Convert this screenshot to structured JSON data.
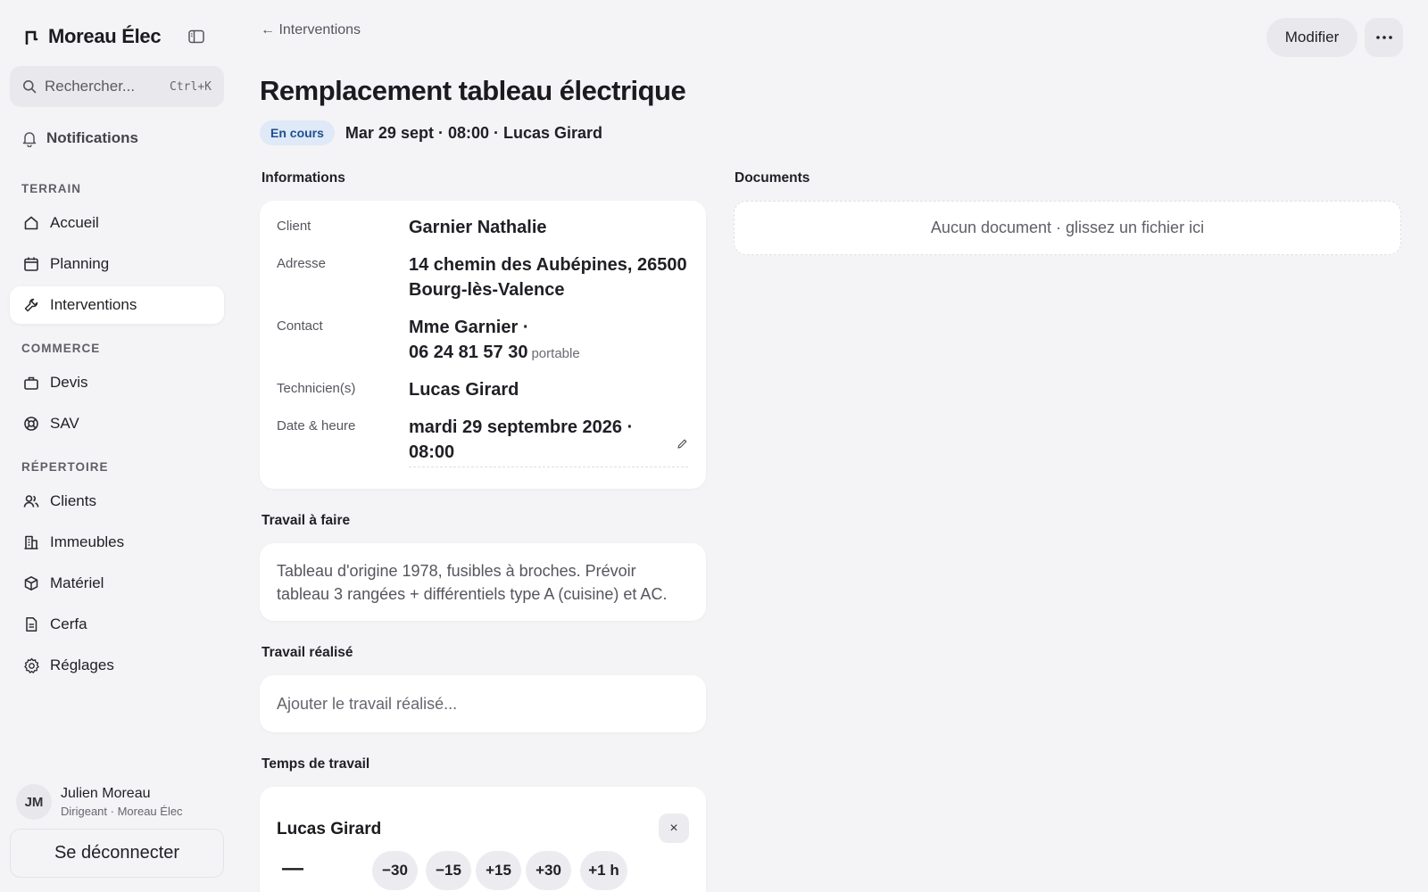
{
  "sidebar": {
    "brand": "Moreau Élec",
    "search_placeholder": "Rechercher...",
    "search_shortcut": "Ctrl+K",
    "notifications": "Notifications",
    "sections": {
      "terrain": "TERRAIN",
      "commerce": "COMMERCE",
      "repertoire": "RÉPERTOIRE"
    },
    "items": {
      "accueil": "Accueil",
      "planning": "Planning",
      "interventions": "Interventions",
      "devis": "Devis",
      "sav": "SAV",
      "clients": "Clients",
      "immeubles": "Immeubles",
      "materiel": "Matériel",
      "cerfa": "Cerfa",
      "reglages": "Réglages"
    },
    "active_item": "interventions",
    "user": {
      "initials": "JM",
      "name": "Julien Moreau",
      "role": "Dirigeant · Moreau Élec"
    },
    "logout": "Se déconnecter"
  },
  "header": {
    "breadcrumb": "← Interventions",
    "modifier": "Modifier",
    "more_icon": "more-horizontal-icon"
  },
  "intervention": {
    "title": "Remplacement tableau électrique",
    "status": "En cours",
    "status_color": "#dfe9f7",
    "summary": "Mar 29 sept · 08:00 · Lucas Girard"
  },
  "informations": {
    "title": "Informations",
    "client_label": "Client",
    "client_value": "Garnier Nathalie",
    "adresse_label": "Adresse",
    "adresse_line1": "14 chemin des Aubépines, 26500",
    "adresse_line2": "Bourg-lès-Valence",
    "contact_label": "Contact",
    "contact_line1": "Mme Garnier ·",
    "contact_phone": "06 24 81 57 30",
    "contact_note": "portable",
    "techniciens_label": "Technicien(s)",
    "techniciens_value": "Lucas Girard",
    "date_label": "Date & heure",
    "date_line1": "mardi 29 septembre 2026 ·",
    "date_line2": "08:00"
  },
  "travail_a_faire": {
    "title": "Travail à faire",
    "text": "Tableau d'origine 1978, fusibles à broches. Prévoir tableau 3 rangées + différentiels type A (cuisine) et AC."
  },
  "travail_realise": {
    "title": "Travail réalisé",
    "placeholder": "Ajouter le travail réalisé..."
  },
  "temps_de_travail": {
    "title": "Temps de travail",
    "technicien": "Lucas Girard",
    "total": "—",
    "close": "×",
    "buttons": [
      "−30",
      "−15",
      "+15",
      "+30",
      "+1 h"
    ]
  },
  "documents": {
    "title": "Documents",
    "empty": "Aucun document · glissez un fichier ici"
  }
}
